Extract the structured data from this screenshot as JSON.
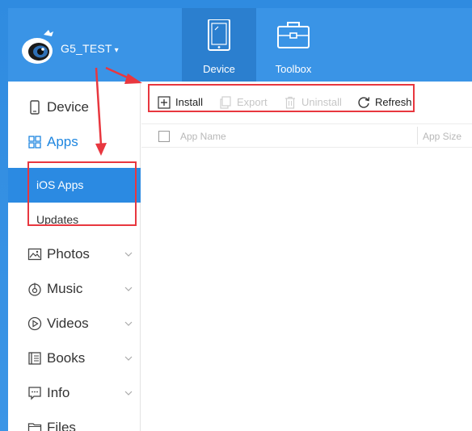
{
  "header": {
    "device_name": "G5_TEST",
    "device_caret": "▾",
    "tabs": [
      {
        "label": "Device",
        "icon": "tablet-icon",
        "active": true
      },
      {
        "label": "Toolbox",
        "icon": "toolbox-icon",
        "active": false
      }
    ]
  },
  "sidebar": {
    "items": [
      {
        "label": "Device",
        "icon": "device-icon"
      },
      {
        "label": "Apps",
        "icon": "apps-grid-icon"
      },
      {
        "label": "iOS Apps"
      },
      {
        "label": "Updates"
      },
      {
        "label": "Photos",
        "icon": "photos-icon"
      },
      {
        "label": "Music",
        "icon": "music-icon"
      },
      {
        "label": "Videos",
        "icon": "videos-icon"
      },
      {
        "label": "Books",
        "icon": "books-icon"
      },
      {
        "label": "Info",
        "icon": "info-icon"
      },
      {
        "label": "Files",
        "icon": "files-icon"
      }
    ]
  },
  "toolbar": {
    "install": "Install",
    "export": "Export",
    "uninstall": "Uninstall",
    "refresh": "Refresh"
  },
  "table": {
    "columns": [
      "App Name",
      "App Size"
    ]
  },
  "colors": {
    "header_blue": "#3a94e6",
    "active_tab": "#2b7fcf",
    "selected_item": "#2b8ae2",
    "accent_text": "#1e86e0",
    "annotation_red": "#e8373f"
  }
}
